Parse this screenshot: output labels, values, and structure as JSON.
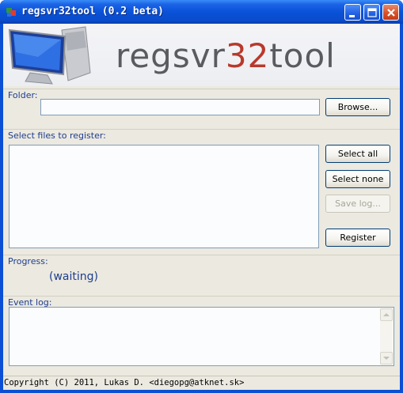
{
  "window": {
    "title": "regsvr32tool (0.2 beta)"
  },
  "banner": {
    "brand_prefix": "regsvr",
    "brand_accent": "32",
    "brand_suffix": "tool"
  },
  "folder": {
    "label": "Folder:",
    "value": "",
    "browse_label": "Browse..."
  },
  "files": {
    "label": "Select files to register:",
    "items": [],
    "select_all_label": "Select all",
    "select_none_label": "Select none",
    "save_log_label": "Save log...",
    "register_label": "Register"
  },
  "progress": {
    "label": "Progress:",
    "status": "(waiting)"
  },
  "event_log": {
    "label": "Event log:",
    "text": ""
  },
  "statusbar": {
    "text": "Copyright (C) 2011, Lukas D. <diegopg@atknet.sk>"
  },
  "colors": {
    "titlebar": "#0a52d8",
    "accent_red": "#b8392c",
    "label_blue": "#1f3d8f",
    "client_bg": "#ebe9e0"
  },
  "icons": [
    "app-icon",
    "minimize-icon",
    "maximize-icon",
    "close-icon",
    "monitor-logo",
    "scroll-up-icon",
    "scroll-down-icon"
  ]
}
